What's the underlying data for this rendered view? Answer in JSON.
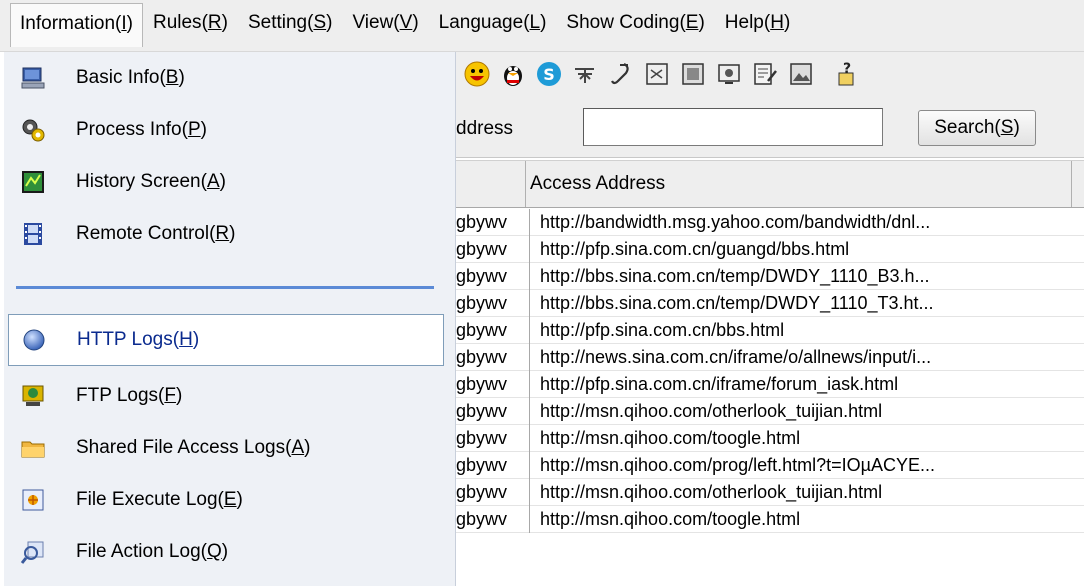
{
  "menubar": {
    "items": [
      {
        "label": "Information",
        "key": "I"
      },
      {
        "label": "Rules",
        "key": "R"
      },
      {
        "label": "Setting",
        "key": "S"
      },
      {
        "label": "View",
        "key": "V"
      },
      {
        "label": "Language",
        "key": "L"
      },
      {
        "label": "Show Coding",
        "key": "E"
      },
      {
        "label": "Help",
        "key": "H"
      }
    ]
  },
  "dropdown": {
    "items": [
      {
        "label": "Basic Info",
        "key": "B",
        "icon": "computer-icon"
      },
      {
        "label": "Process Info",
        "key": "P",
        "icon": "gears-icon"
      },
      {
        "label": "History Screen",
        "key": "A",
        "icon": "screen-history-icon"
      },
      {
        "label": "Remote Control",
        "key": "R",
        "icon": "film-icon"
      },
      {
        "label": "HTTP Logs",
        "key": "H",
        "icon": "globe-icon"
      },
      {
        "label": "FTP Logs",
        "key": "F",
        "icon": "ftp-monitor-icon"
      },
      {
        "label": "Shared File Access Logs",
        "key": "A",
        "icon": "folder-icon"
      },
      {
        "label": "File Execute Log",
        "key": "E",
        "icon": "file-execute-icon"
      },
      {
        "label": "File Action Log",
        "key": "Q",
        "icon": "magnifier-icon"
      }
    ],
    "selected_label": "HTTP Logs"
  },
  "filter": {
    "label": "ddress",
    "input_value": "",
    "search_label": "Search",
    "search_key": "S"
  },
  "table": {
    "columns": [
      "",
      "Access Address"
    ],
    "rows": [
      {
        "user": "gbywv",
        "address": "http://bandwidth.msg.yahoo.com/bandwidth/dnl..."
      },
      {
        "user": "gbywv",
        "address": "http://pfp.sina.com.cn/guangd/bbs.html"
      },
      {
        "user": "gbywv",
        "address": "http://bbs.sina.com.cn/temp/DWDY_1110_B3.h..."
      },
      {
        "user": "gbywv",
        "address": "http://bbs.sina.com.cn/temp/DWDY_1110_T3.ht..."
      },
      {
        "user": "gbywv",
        "address": "http://pfp.sina.com.cn/bbs.html"
      },
      {
        "user": "gbywv",
        "address": "http://news.sina.com.cn/iframe/o/allnews/input/i..."
      },
      {
        "user": "gbywv",
        "address": "http://pfp.sina.com.cn/iframe/forum_iask.html"
      },
      {
        "user": "gbywv",
        "address": "http://msn.qihoo.com/otherlook_tuijian.html"
      },
      {
        "user": "gbywv",
        "address": "http://msn.qihoo.com/toogle.html"
      },
      {
        "user": "gbywv",
        "address": "http://msn.qihoo.com/prog/left.html?t=IOµACYE..."
      },
      {
        "user": "gbywv",
        "address": "http://msn.qihoo.com/otherlook_tuijian.html"
      },
      {
        "user": "gbywv",
        "address": "http://msn.qihoo.com/toogle.html"
      }
    ]
  },
  "colors": {
    "menubar_bg": "#eeeeee",
    "dropdown_bg": "#eef1f6",
    "separator": "#5b8ad6",
    "selected_text": "#0a2a8e"
  }
}
